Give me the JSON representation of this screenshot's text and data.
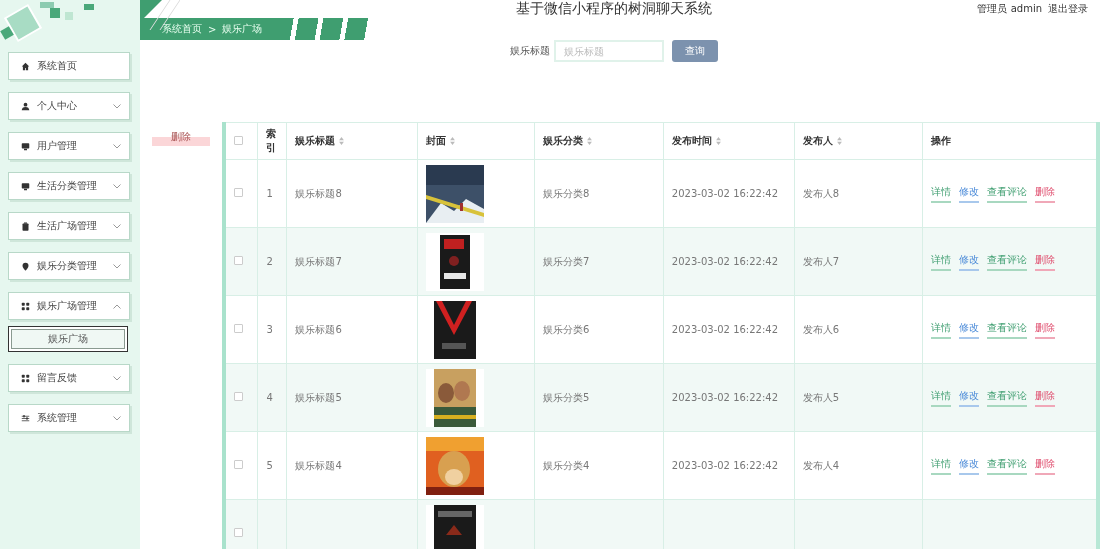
{
  "header": {
    "title": "基于微信小程序的树洞聊天系统",
    "user_role": "管理员 admin",
    "logout": "退出登录"
  },
  "breadcrumb": {
    "home": "系统首页",
    "separator": ">",
    "current": "娱乐广场"
  },
  "sidebar": {
    "items": [
      {
        "label": "系统首页"
      },
      {
        "label": "个人中心",
        "expanded": false
      },
      {
        "label": "用户管理",
        "expanded": false
      },
      {
        "label": "生活分类管理",
        "expanded": false
      },
      {
        "label": "生活广场管理",
        "expanded": false
      },
      {
        "label": "娱乐分类管理",
        "expanded": false
      },
      {
        "label": "娱乐广场管理",
        "expanded": true,
        "children": [
          {
            "label": "娱乐广场",
            "selected": true
          }
        ]
      },
      {
        "label": "留言反馈",
        "expanded": false
      },
      {
        "label": "系统管理",
        "expanded": false
      }
    ]
  },
  "search": {
    "label": "娱乐标题",
    "placeholder": "娱乐标题",
    "button": "查询"
  },
  "delete_button": "删除",
  "table": {
    "all_checked": false,
    "columns": [
      {
        "label": "索引",
        "sortable": false
      },
      {
        "label": "娱乐标题",
        "sortable": true
      },
      {
        "label": "封面",
        "sortable": true
      },
      {
        "label": "娱乐分类",
        "sortable": true
      },
      {
        "label": "发布时间",
        "sortable": true
      },
      {
        "label": "发布人",
        "sortable": true
      },
      {
        "label": "操作",
        "sortable": false
      }
    ],
    "rows": [
      {
        "checked": false,
        "index": "1",
        "title": "娱乐标题8",
        "category": "娱乐分类8",
        "time": "2023-03-02 16:22:42",
        "author": "发布人8",
        "actions": [
          {
            "label": "详情",
            "kind": "view"
          },
          {
            "label": "修改",
            "kind": "edit"
          },
          {
            "label": "查看评论",
            "kind": "view"
          },
          {
            "label": "删除",
            "kind": "delete"
          }
        ]
      },
      {
        "checked": false,
        "index": "2",
        "title": "娱乐标题7",
        "category": "娱乐分类7",
        "time": "2023-03-02 16:22:42",
        "author": "发布人7",
        "actions": [
          {
            "label": "详情",
            "kind": "view"
          },
          {
            "label": "修改",
            "kind": "edit"
          },
          {
            "label": "查看评论",
            "kind": "view"
          },
          {
            "label": "删除",
            "kind": "delete"
          }
        ]
      },
      {
        "checked": false,
        "index": "3",
        "title": "娱乐标题6",
        "category": "娱乐分类6",
        "time": "2023-03-02 16:22:42",
        "author": "发布人6",
        "actions": [
          {
            "label": "详情",
            "kind": "view"
          },
          {
            "label": "修改",
            "kind": "edit"
          },
          {
            "label": "查看评论",
            "kind": "view"
          },
          {
            "label": "删除",
            "kind": "delete"
          }
        ]
      },
      {
        "checked": false,
        "index": "4",
        "title": "娱乐标题5",
        "category": "娱乐分类5",
        "time": "2023-03-02 16:22:42",
        "author": "发布人5",
        "actions": [
          {
            "label": "详情",
            "kind": "view"
          },
          {
            "label": "修改",
            "kind": "edit"
          },
          {
            "label": "查看评论",
            "kind": "view"
          },
          {
            "label": "删除",
            "kind": "delete"
          }
        ]
      },
      {
        "checked": false,
        "index": "5",
        "title": "娱乐标题4",
        "category": "娱乐分类4",
        "time": "2023-03-02 16:22:42",
        "author": "发布人4",
        "actions": [
          {
            "label": "详情",
            "kind": "view"
          },
          {
            "label": "修改",
            "kind": "edit"
          },
          {
            "label": "查看评论",
            "kind": "view"
          },
          {
            "label": "删除",
            "kind": "delete"
          }
        ]
      },
      {
        "checked": false
      }
    ]
  }
}
